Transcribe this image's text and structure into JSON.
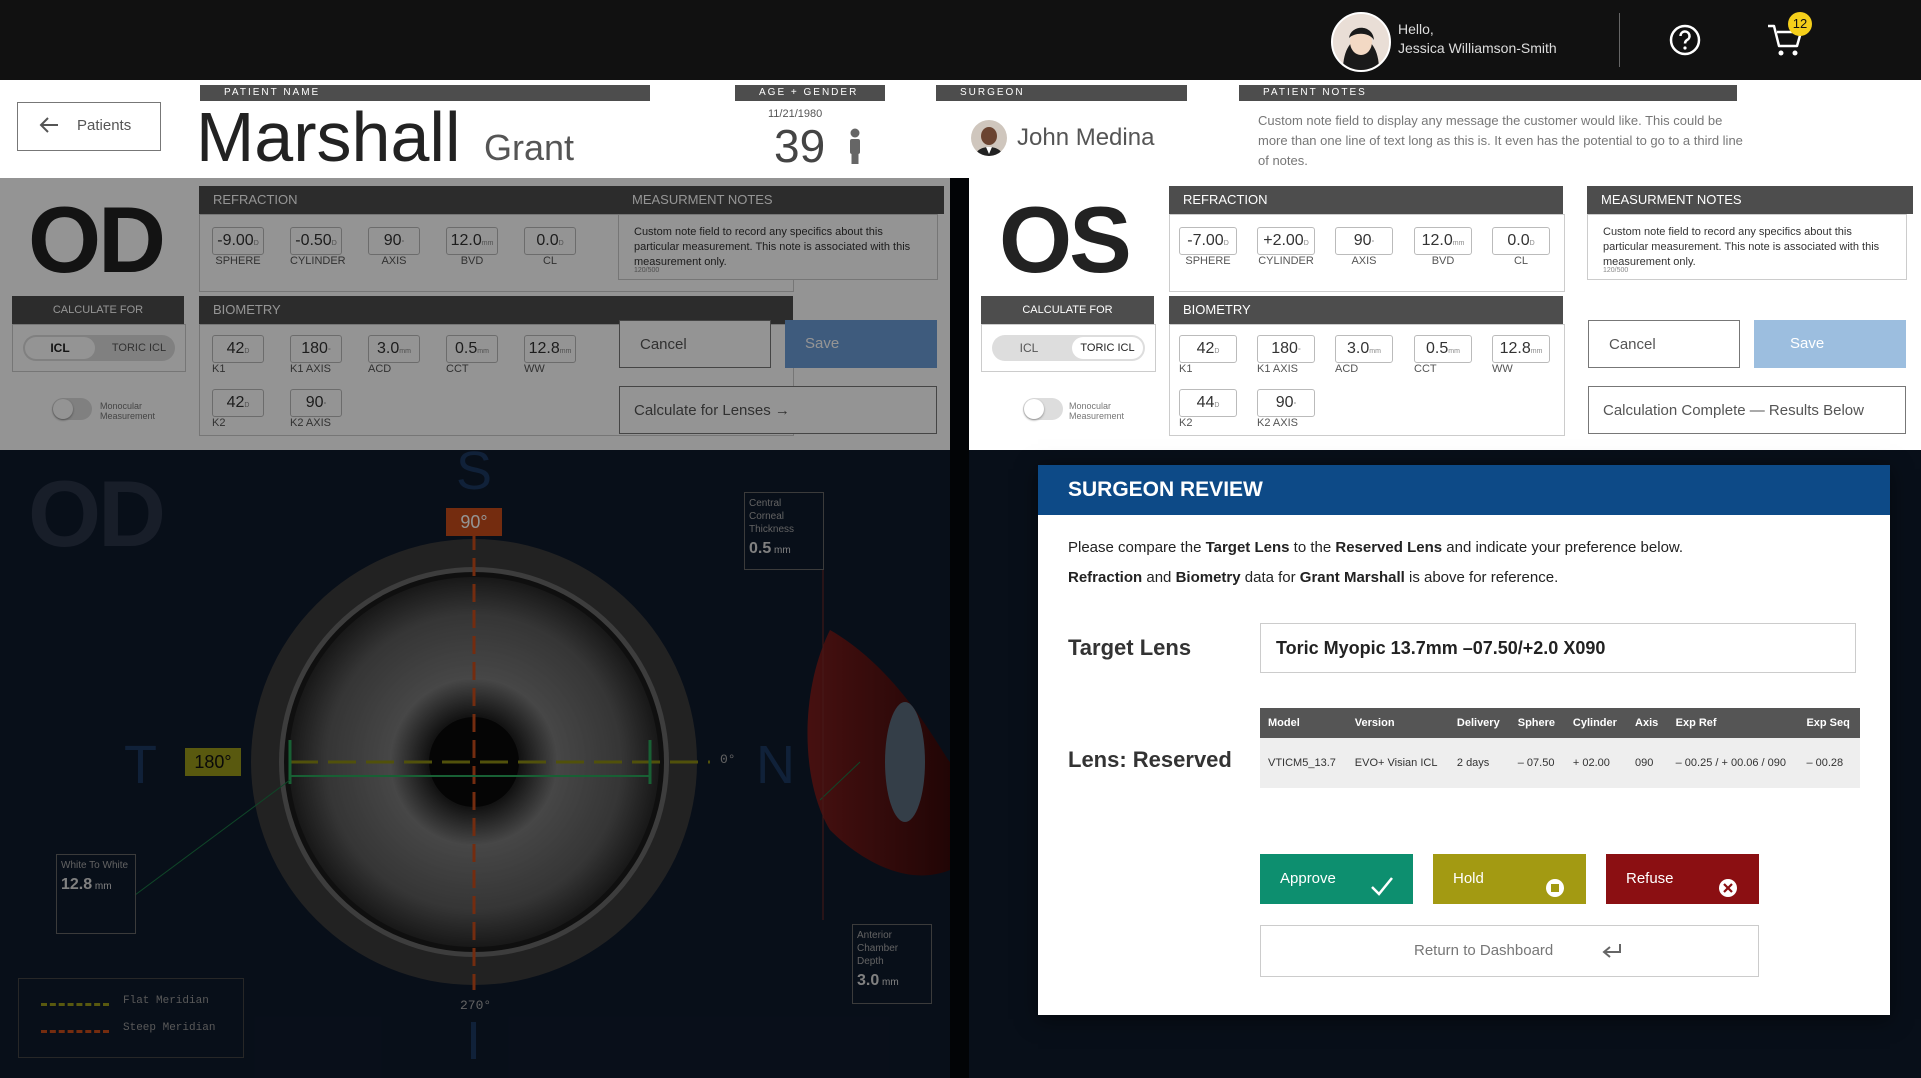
{
  "topbar": {
    "greeting": "Hello,",
    "user_name": "Jessica Williamson-Smith",
    "cart_count": "12"
  },
  "header": {
    "back_label": "Patients",
    "patient_label": "PATIENT NAME",
    "last_name": "Marshall",
    "first_name": "Grant",
    "age_label": "AGE + GENDER",
    "dob": "11/21/1980",
    "age": "39",
    "surgeon_label": "SURGEON",
    "surgeon_name": "John Medina",
    "notes_label": "PATIENT NOTES",
    "notes_text": "Custom note field to display any message the customer would like. This could be more than one line of text long as this is. It even has the potential to go to a third line of notes."
  },
  "od": {
    "eye": "OD",
    "refraction_title": "REFRACTION",
    "refraction": [
      {
        "value": "-9.00",
        "unit": "D",
        "label": "SPHERE"
      },
      {
        "value": "-0.50",
        "unit": "D",
        "label": "CYLINDER"
      },
      {
        "value": "90",
        "unit": "°",
        "label": "AXIS"
      },
      {
        "value": "12.0",
        "unit": "mm",
        "label": "BVD"
      },
      {
        "value": "0.0",
        "unit": "D",
        "label": "CL"
      }
    ],
    "notes_title": "MEASURMENT NOTES",
    "notes_text": "Custom note field to record any specifics about this particular measurement. This note is associated with this measurement only.",
    "notes_count": "120/500",
    "calc_title": "CALCULATE FOR",
    "opt1": "ICL",
    "opt2": "TORIC ICL",
    "monocular": "Monocular Measurement",
    "biometry_title": "BIOMETRY",
    "biometry": [
      {
        "value": "42",
        "unit": "D",
        "label": "K1"
      },
      {
        "value": "180",
        "unit": "°",
        "label": "K1 AXIS"
      },
      {
        "value": "3.0",
        "unit": "mm",
        "label": "ACD"
      },
      {
        "value": "0.5",
        "unit": "mm",
        "label": "CCT"
      },
      {
        "value": "12.8",
        "unit": "mm",
        "label": "WW"
      },
      {
        "value": "42",
        "unit": "D",
        "label": "K2"
      },
      {
        "value": "90",
        "unit": "°",
        "label": "K2 AXIS"
      }
    ],
    "cancel": "Cancel",
    "save": "Save",
    "calc_btn": "Calculate for Lenses"
  },
  "os": {
    "eye": "OS",
    "refraction_title": "REFRACTION",
    "refraction": [
      {
        "value": "-7.00",
        "unit": "D",
        "label": "SPHERE"
      },
      {
        "value": "+2.00",
        "unit": "D",
        "label": "CYLINDER"
      },
      {
        "value": "90",
        "unit": "°",
        "label": "AXIS"
      },
      {
        "value": "12.0",
        "unit": "mm",
        "label": "BVD"
      },
      {
        "value": "0.0",
        "unit": "D",
        "label": "CL"
      }
    ],
    "notes_title": "MEASURMENT NOTES",
    "notes_text": "Custom note field to record any specifics about this particular measurement. This note is associated with this measurement only.",
    "notes_count": "120/500",
    "calc_title": "CALCULATE FOR",
    "opt1": "ICL",
    "opt2": "TORIC ICL",
    "monocular": "Monocular Measurement",
    "biometry_title": "BIOMETRY",
    "biometry": [
      {
        "value": "42",
        "unit": "D",
        "label": "K1"
      },
      {
        "value": "180",
        "unit": "°",
        "label": "K1 AXIS"
      },
      {
        "value": "3.0",
        "unit": "mm",
        "label": "ACD"
      },
      {
        "value": "0.5",
        "unit": "mm",
        "label": "CCT"
      },
      {
        "value": "12.8",
        "unit": "mm",
        "label": "WW"
      },
      {
        "value": "44",
        "unit": "D",
        "label": "K2"
      },
      {
        "value": "90",
        "unit": "°",
        "label": "K2 AXIS"
      }
    ],
    "cancel": "Cancel",
    "save": "Save",
    "calc_btn": "Calculation Complete — Results Below"
  },
  "eye_view": {
    "od_label": "OD",
    "s": "S",
    "t": "T",
    "n": "N",
    "i": "I",
    "deg90": "90°",
    "deg180": "180°",
    "deg0": "0°",
    "deg270": "270°",
    "cct_label": "Central Corneal Thickness",
    "cct_value": "0.5",
    "cct_unit": "mm",
    "ww_label": "White To White",
    "ww_value": "12.8",
    "ww_unit": "mm",
    "acd_label": "Anterior Chamber Depth",
    "acd_value": "3.0",
    "acd_unit": "mm",
    "flat": "Flat Meridian",
    "steep": "Steep Meridian",
    "colors": {
      "flat": "#9a9a1a",
      "steep": "#d2501e"
    }
  },
  "modal": {
    "title": "SURGEON REVIEW",
    "l1_a": "Please compare the ",
    "l1_b": "Target Lens",
    "l1_c": " to the ",
    "l1_d": "Reserved Lens",
    "l1_e": " and indicate your preference below.",
    "l2_a": "Refraction",
    "l2_b": " and ",
    "l2_c": "Biometry",
    "l2_d": " data for ",
    "l2_e": "Grant Marshall",
    "l2_f": " is above for reference.",
    "target_label": "Target Lens",
    "target_value": "Toric Myopic 13.7mm –07.50/+2.0 X090",
    "reserved_label": "Lens: Reserved",
    "columns": [
      "Model",
      "Version",
      "Delivery",
      "Sphere",
      "Cylinder",
      "Axis",
      "Exp Ref",
      "Exp Seq"
    ],
    "row": [
      "VTICM5_13.7",
      "EVO+ Visian ICL",
      "2 days",
      "– 07.50",
      "+ 02.00",
      "090",
      "– 00.25 / + 00.06 / 090",
      "– 00.28"
    ],
    "approve": "Approve",
    "hold": "Hold",
    "refuse": "Refuse",
    "return": "Return to Dashboard",
    "colors": {
      "header": "#0d4a87",
      "approve": "#0d8f6f",
      "hold": "#a39a12",
      "refuse": "#8b0f12"
    }
  }
}
